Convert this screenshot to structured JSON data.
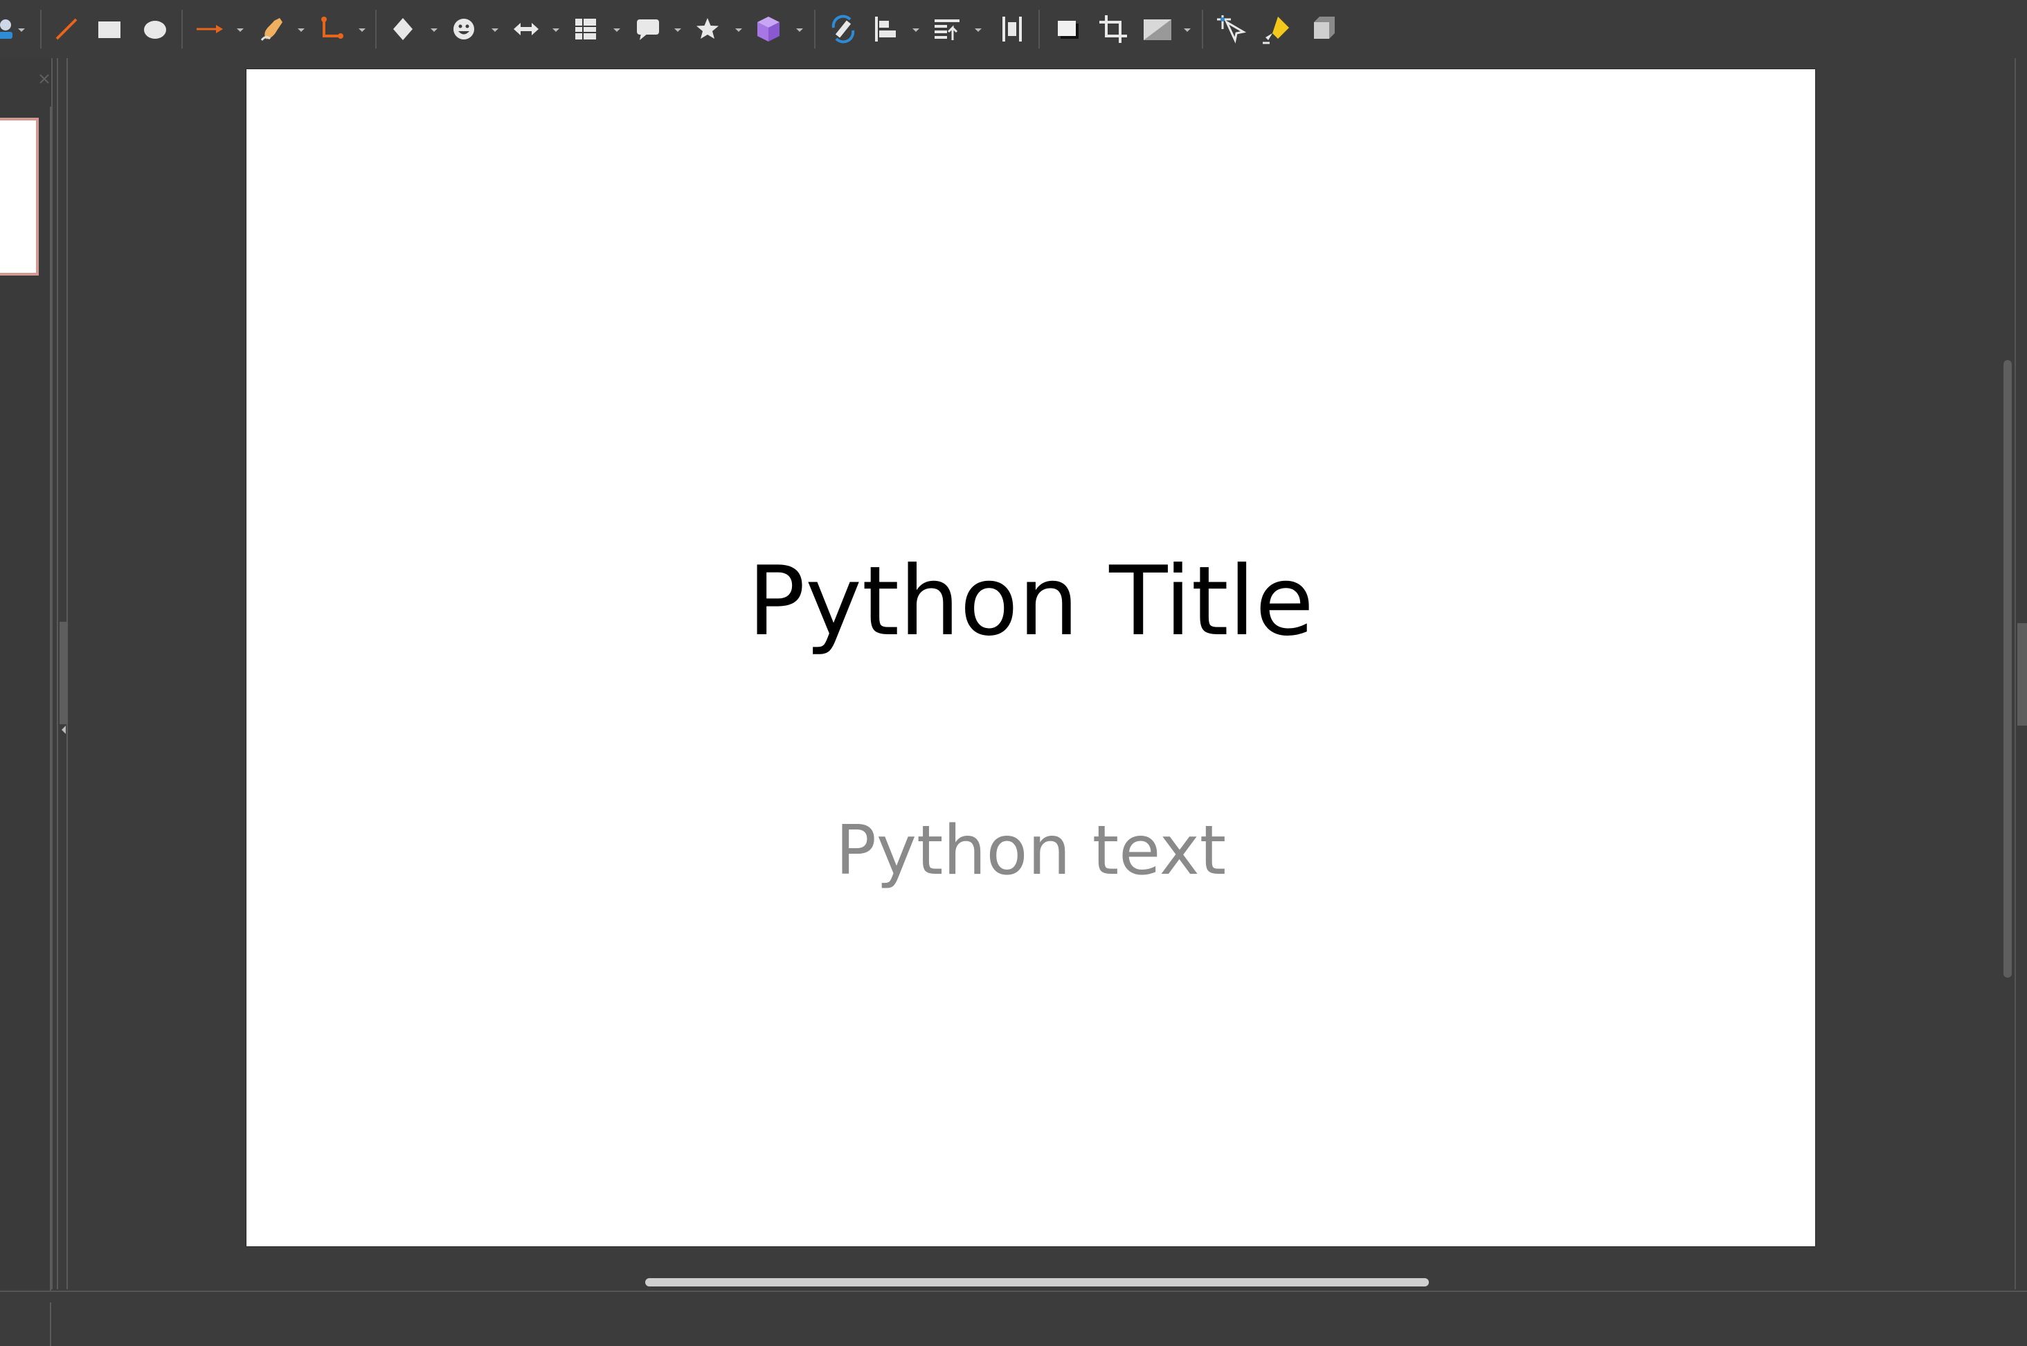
{
  "toolbar": {
    "tools": [
      {
        "name": "select-tool",
        "icon": "pointer-icon"
      },
      {
        "name": "line-tool",
        "icon": "line-icon"
      },
      {
        "name": "rectangle-tool",
        "icon": "rectangle-icon"
      },
      {
        "name": "ellipse-tool",
        "icon": "ellipse-icon"
      },
      {
        "name": "lines-arrows-tool",
        "icon": "arrow-line-icon"
      },
      {
        "name": "curves-polygons-tool",
        "icon": "curve-icon"
      },
      {
        "name": "connectors-tool",
        "icon": "connector-icon"
      },
      {
        "name": "basic-shapes-tool",
        "icon": "diamond-icon"
      },
      {
        "name": "symbol-shapes-tool",
        "icon": "smiley-icon"
      },
      {
        "name": "block-arrows-tool",
        "icon": "double-arrow-icon"
      },
      {
        "name": "flowchart-tool",
        "icon": "flowchart-icon"
      },
      {
        "name": "callouts-tool",
        "icon": "callout-icon"
      },
      {
        "name": "stars-tool",
        "icon": "star-icon"
      },
      {
        "name": "3d-objects-tool",
        "icon": "cube-icon"
      },
      {
        "name": "rotate-tool",
        "icon": "rotate-icon"
      },
      {
        "name": "align-tool",
        "icon": "align-left-icon"
      },
      {
        "name": "arrange-tool",
        "icon": "arrange-icon"
      },
      {
        "name": "distribute-tool",
        "icon": "distribute-icon"
      },
      {
        "name": "shadow-tool",
        "icon": "shadow-icon"
      },
      {
        "name": "crop-tool",
        "icon": "crop-icon"
      },
      {
        "name": "filter-tool",
        "icon": "image-filter-icon"
      },
      {
        "name": "points-tool",
        "icon": "points-icon"
      },
      {
        "name": "glue-points-tool",
        "icon": "glue-icon"
      },
      {
        "name": "toggle-extrusion-tool",
        "icon": "extrusion-icon"
      }
    ]
  },
  "slide": {
    "title": "Python Title",
    "text": "Python text",
    "background": "#ffffff"
  },
  "colors": {
    "app_background": "#3c3c3c",
    "thumbnail_selected_border": "#d09a92",
    "subtitle_text": "#8a8a8a",
    "accent_orange": "#e8651c",
    "accent_purple": "#a877e6",
    "accent_blue": "#2e8bd6",
    "accent_yellow": "#f4c81a"
  }
}
